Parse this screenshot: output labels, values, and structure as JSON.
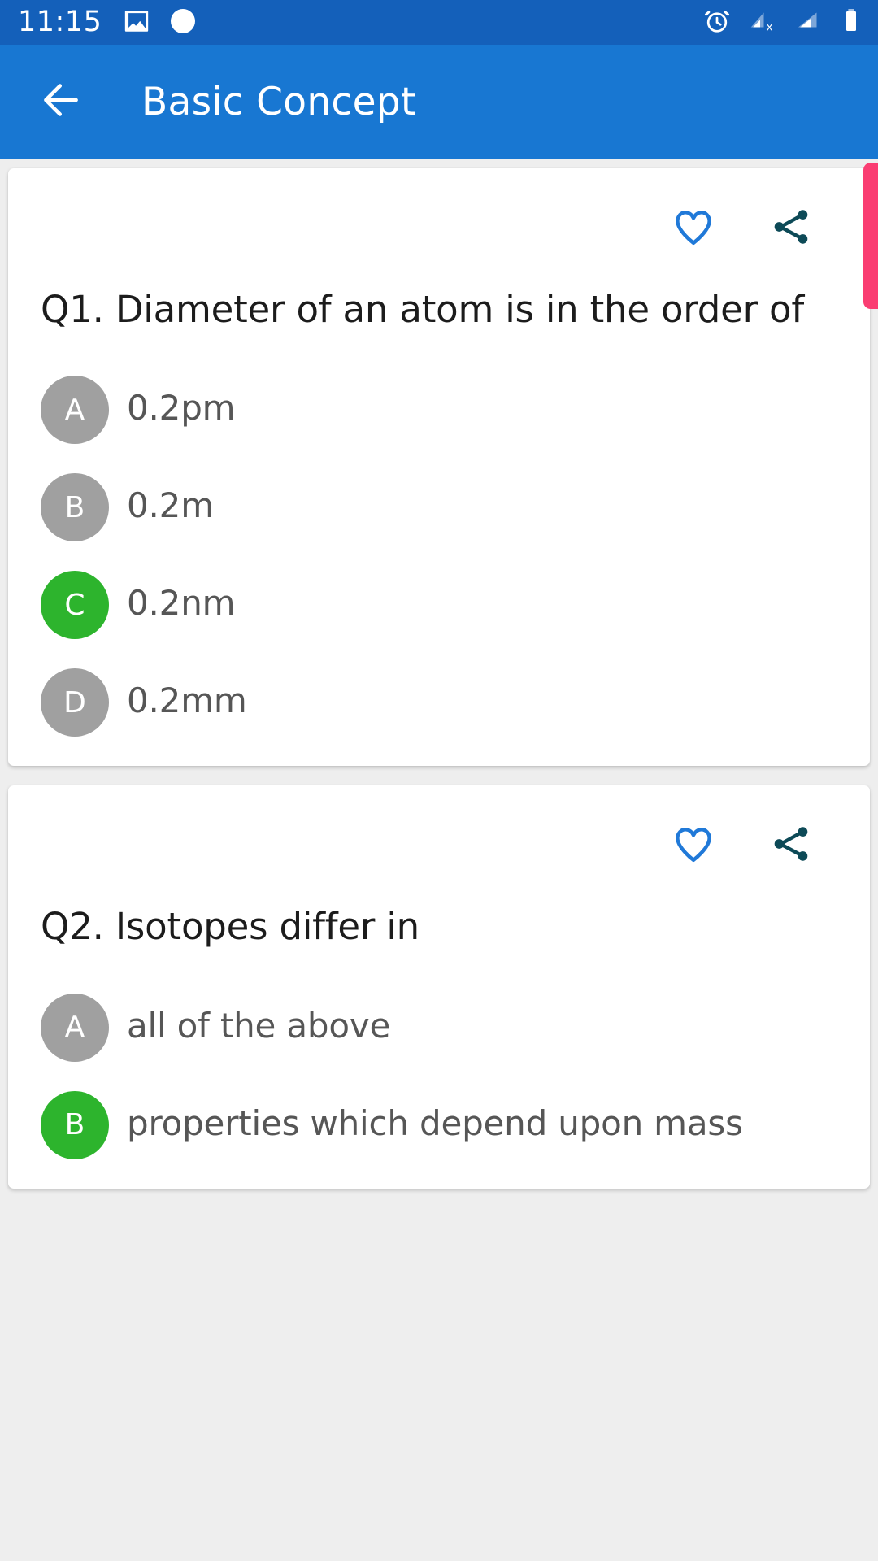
{
  "status_bar": {
    "time": "11:15",
    "left_icons": [
      "image-icon",
      "circle-icon"
    ],
    "right_icons": [
      "alarm-icon",
      "signal-no-data-icon",
      "signal-bars-icon",
      "battery-icon"
    ],
    "background_color": "#1460ba"
  },
  "app_bar": {
    "back_icon": "back-arrow-icon",
    "title": "Basic Concept",
    "background_color": "#1877d2"
  },
  "scrollbar": {
    "thumb_color": "#fa3d72"
  },
  "theme": {
    "page_background": "#eeeeee",
    "card_background": "#ffffff",
    "favorite_icon_color": "#2079d8",
    "share_icon_color": "#0d4a57",
    "option_default_color": "#a0a0a0",
    "option_correct_color": "#2db42d",
    "question_text_color": "#1c1c1c",
    "option_text_color": "#565656"
  },
  "cards": [
    {
      "favorite_icon": "heart-outline-icon",
      "share_icon": "share-icon",
      "question": "Q1. Diameter of an atom is in the order of",
      "options": [
        {
          "letter": "A",
          "text": "0.2pm",
          "correct": false
        },
        {
          "letter": "B",
          "text": "0.2m",
          "correct": false
        },
        {
          "letter": "C",
          "text": "0.2nm",
          "correct": true
        },
        {
          "letter": "D",
          "text": "0.2mm",
          "correct": false
        }
      ]
    },
    {
      "favorite_icon": "heart-outline-icon",
      "share_icon": "share-icon",
      "question": "Q2. Isotopes differ in",
      "options": [
        {
          "letter": "A",
          "text": "all of the above",
          "correct": false
        },
        {
          "letter": "B",
          "text": "properties which depend upon mass",
          "correct": true
        }
      ]
    }
  ]
}
